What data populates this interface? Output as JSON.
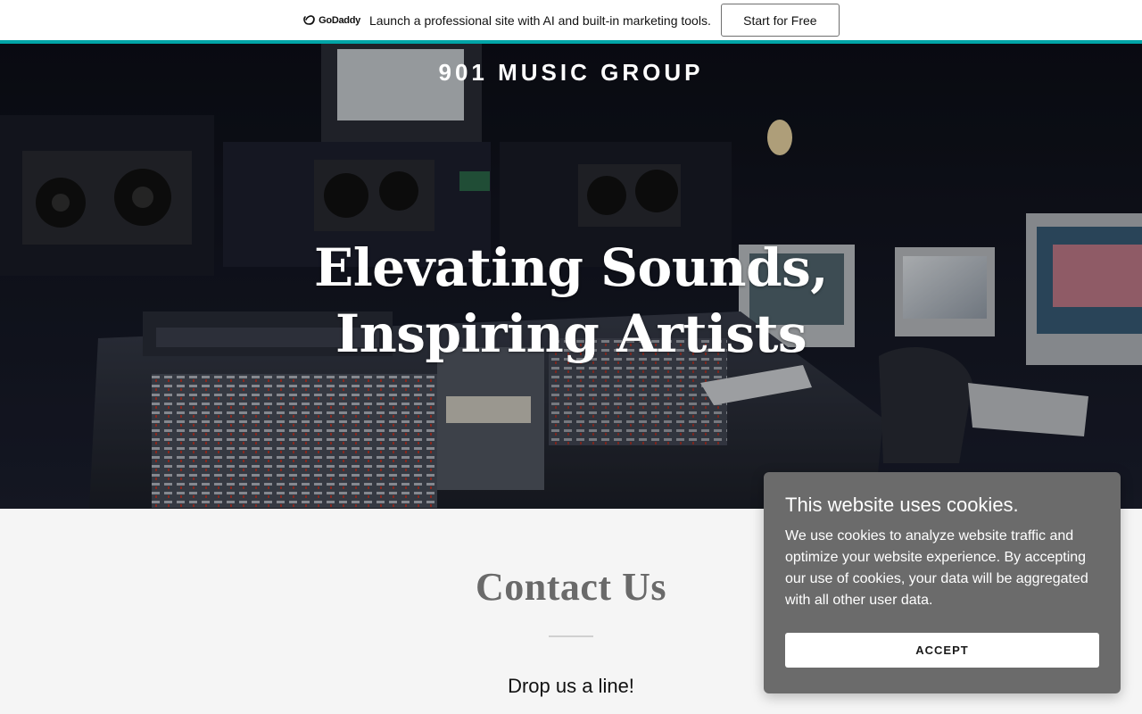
{
  "promo": {
    "logo_text": "GoDaddy",
    "message": "Launch a professional site with AI and built-in marketing tools.",
    "cta_label": "Start for Free",
    "accent_color": "#00a4a6"
  },
  "hero": {
    "site_title": "901 MUSIC GROUP",
    "heading": "Elevating Sounds, Inspiring Artists",
    "background_image": "recording-studio-mixing-console"
  },
  "contact": {
    "title": "Contact Us",
    "subtitle": "Drop us a line!"
  },
  "cookie_banner": {
    "title": "This website uses cookies.",
    "body": "We use cookies to analyze website traffic and optimize your website experience. By accepting our use of cookies, your data will be aggregated with all other user data.",
    "accept_label": "ACCEPT"
  }
}
